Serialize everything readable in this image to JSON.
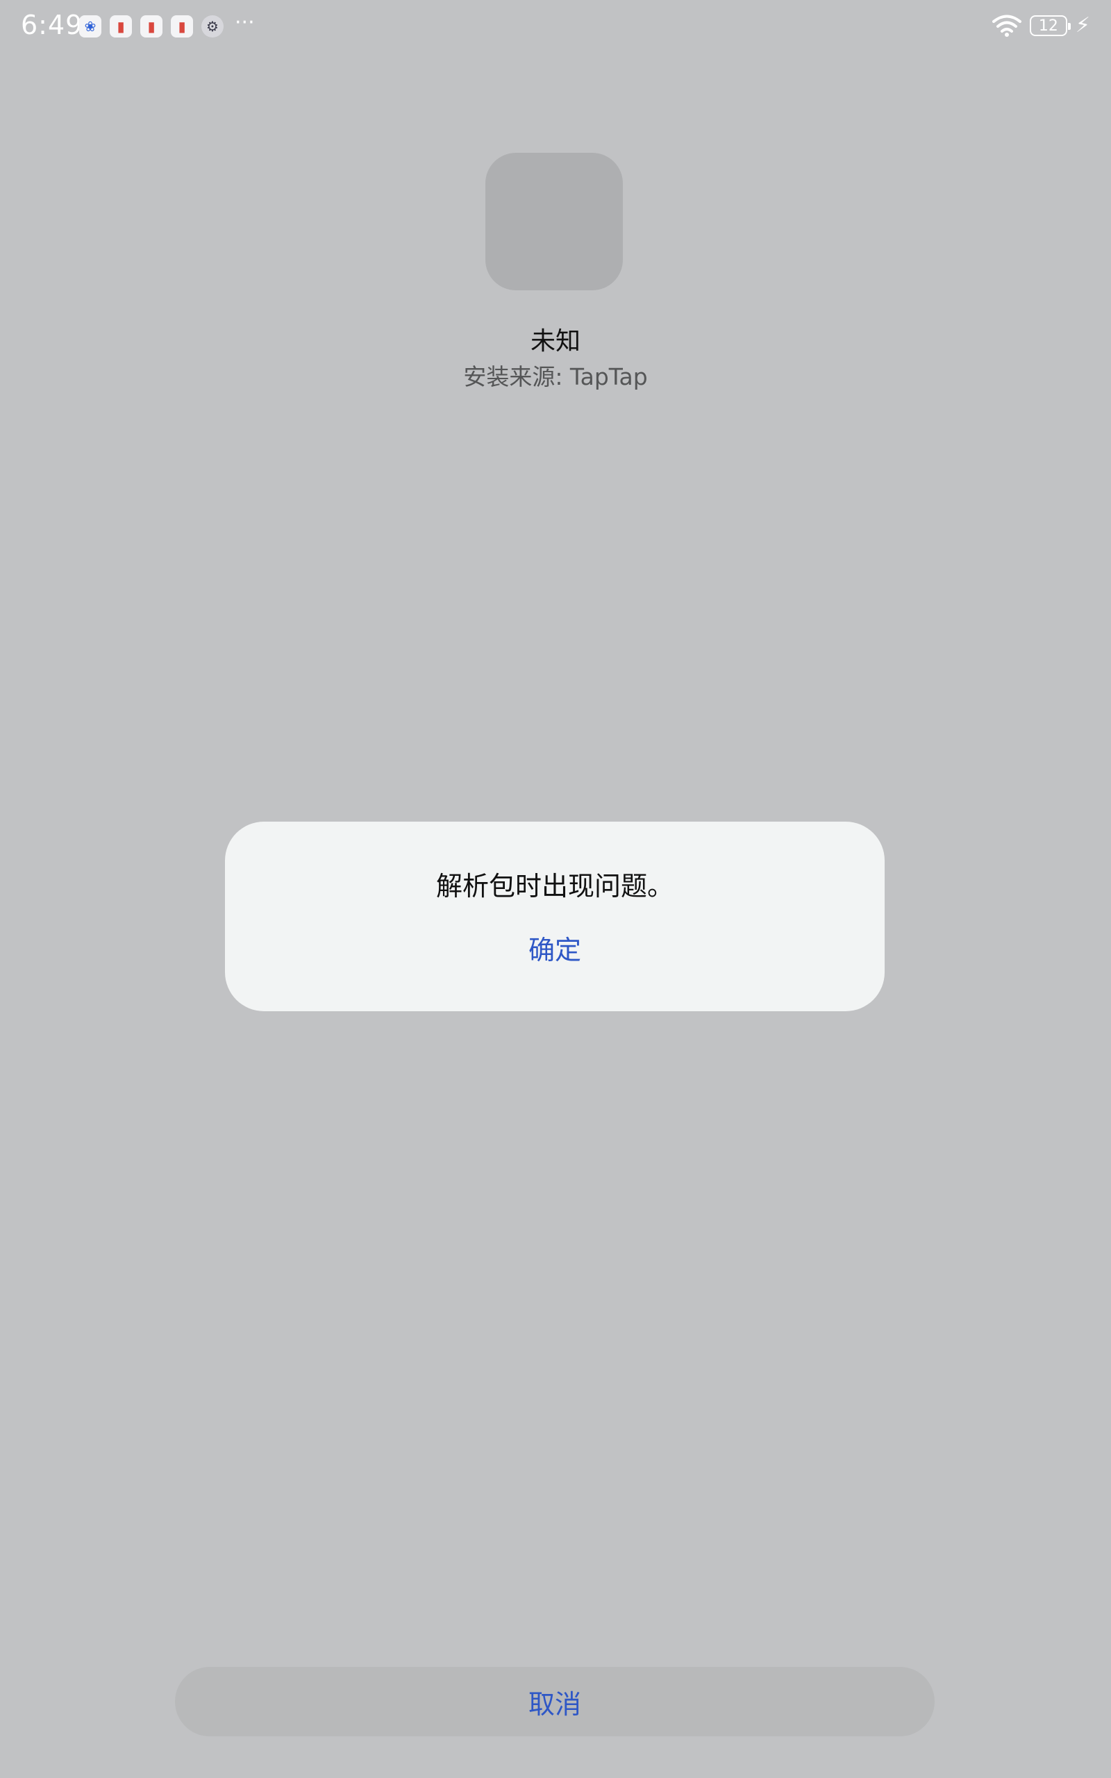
{
  "status_bar": {
    "time": "6:49",
    "battery_level": "12",
    "notification_icons": [
      "baidu-icon",
      "red-book-icon",
      "red-book-icon",
      "red-book-icon",
      "settings-gear-icon"
    ],
    "more_indicator": "···"
  },
  "app": {
    "name": "未知",
    "install_source": "安装来源: TapTap"
  },
  "dialog": {
    "message": "解析包时出现问题。",
    "ok_label": "确定"
  },
  "footer": {
    "cancel_label": "取消"
  },
  "colors": {
    "background": "#c1c2c4",
    "dialog_bg": "#f2f4f4",
    "accent": "#2e57c6",
    "icon_placeholder": "#aeafb1",
    "cancel_bg": "#b8b9ba"
  }
}
